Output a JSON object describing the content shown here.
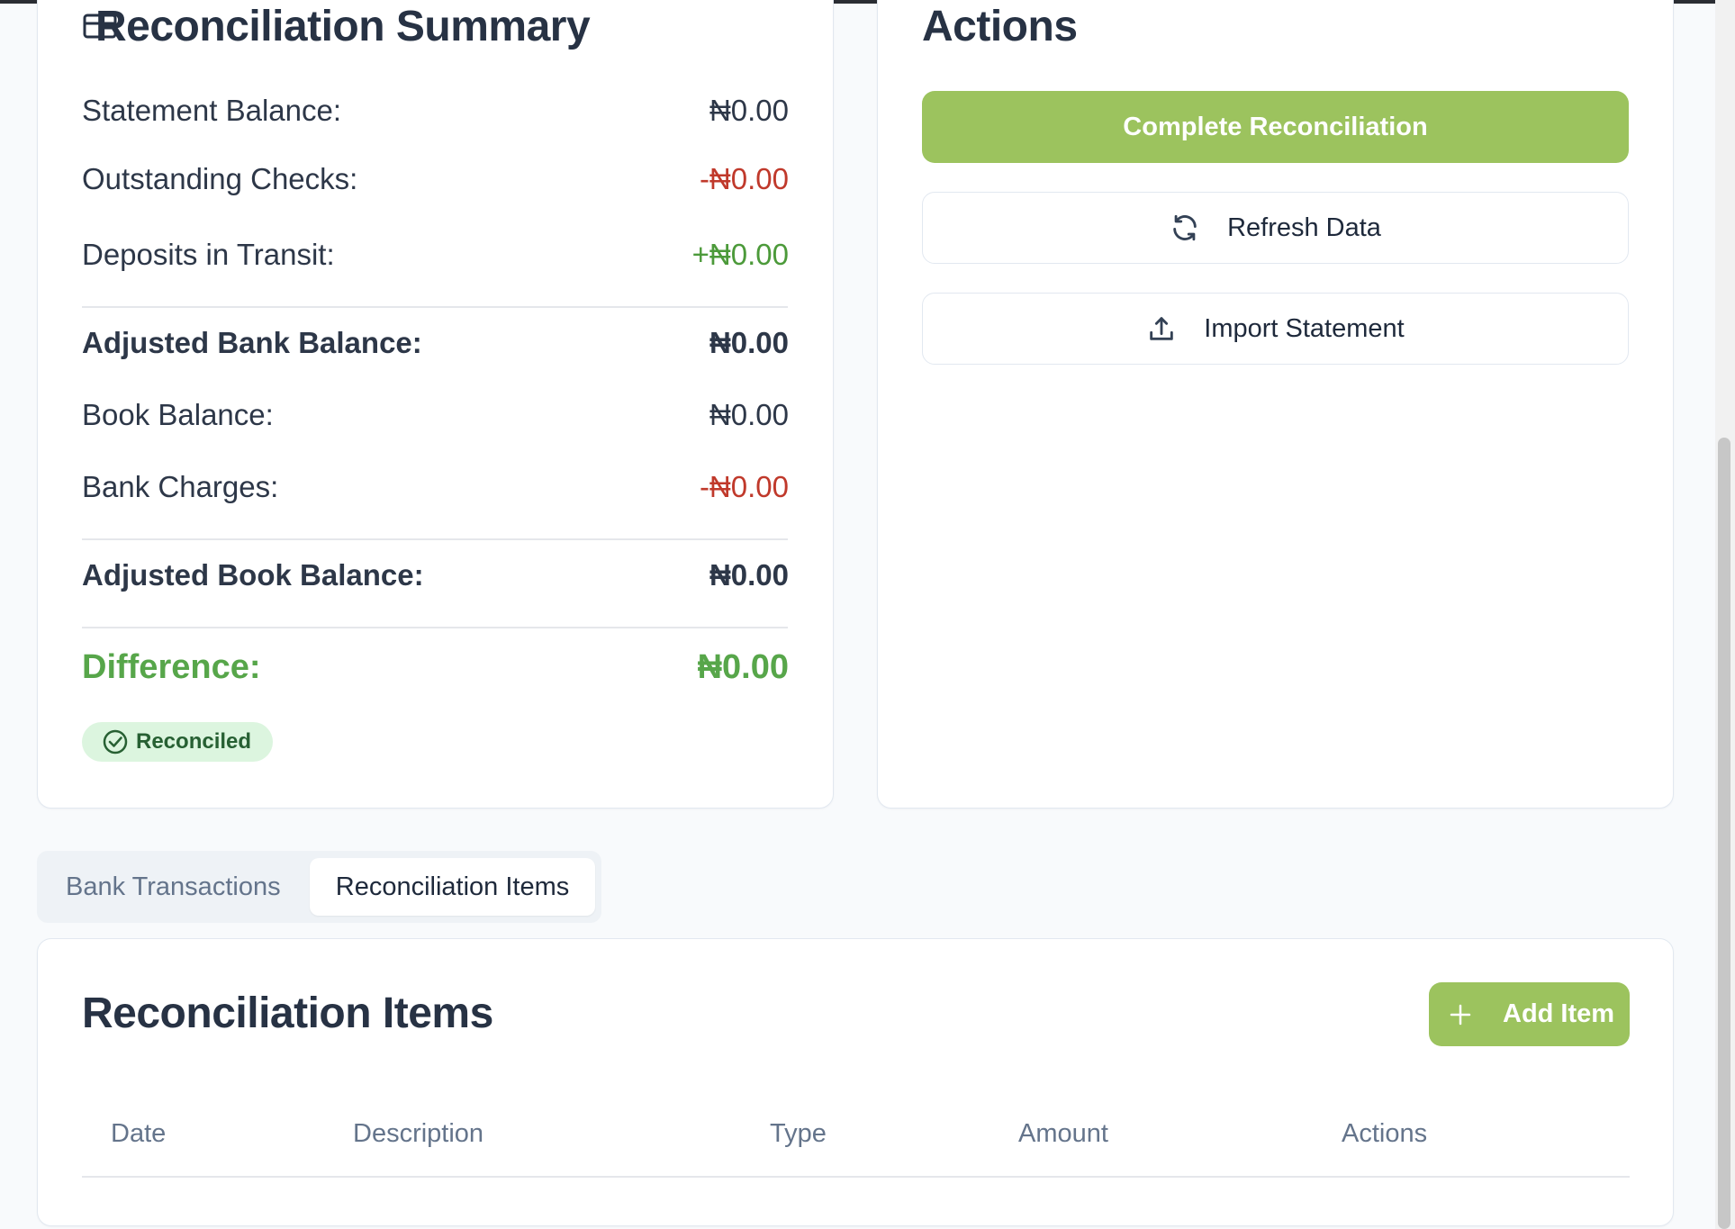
{
  "summary": {
    "title": "Reconciliation Summary",
    "rows": {
      "statement_balance": {
        "label": "Statement Balance:",
        "value": "₦0.00"
      },
      "outstanding_checks": {
        "label": "Outstanding Checks:",
        "value": "-₦0.00"
      },
      "deposits_in_transit": {
        "label": "Deposits in Transit:",
        "value": "+₦0.00"
      },
      "adjusted_bank_balance": {
        "label": "Adjusted Bank Balance:",
        "value": "₦0.00"
      },
      "book_balance": {
        "label": "Book Balance:",
        "value": "₦0.00"
      },
      "bank_charges": {
        "label": "Bank Charges:",
        "value": "-₦0.00"
      },
      "adjusted_book_balance": {
        "label": "Adjusted Book Balance:",
        "value": "₦0.00"
      },
      "difference": {
        "label": "Difference:",
        "value": "₦0.00"
      }
    },
    "status_badge": "Reconciled"
  },
  "actions": {
    "title": "Actions",
    "complete_label": "Complete Reconciliation",
    "refresh_label": "Refresh Data",
    "import_label": "Import Statement"
  },
  "tabs": [
    {
      "label": "Bank Transactions",
      "active": false
    },
    {
      "label": "Reconciliation Items",
      "active": true
    }
  ],
  "items": {
    "title": "Reconciliation Items",
    "add_label": "Add Item",
    "columns": [
      "Date",
      "Description",
      "Type",
      "Amount",
      "Actions"
    ]
  },
  "colors": {
    "accent_green": "#9cc35e",
    "negative_red": "#c0392b",
    "positive_green": "#4c9a3a",
    "badge_bg": "#dcf5df"
  },
  "icons": {
    "summary": "credit-card-icon",
    "refresh": "refresh-icon",
    "import": "upload-icon",
    "badge": "check-circle-icon",
    "add": "plus-icon"
  }
}
